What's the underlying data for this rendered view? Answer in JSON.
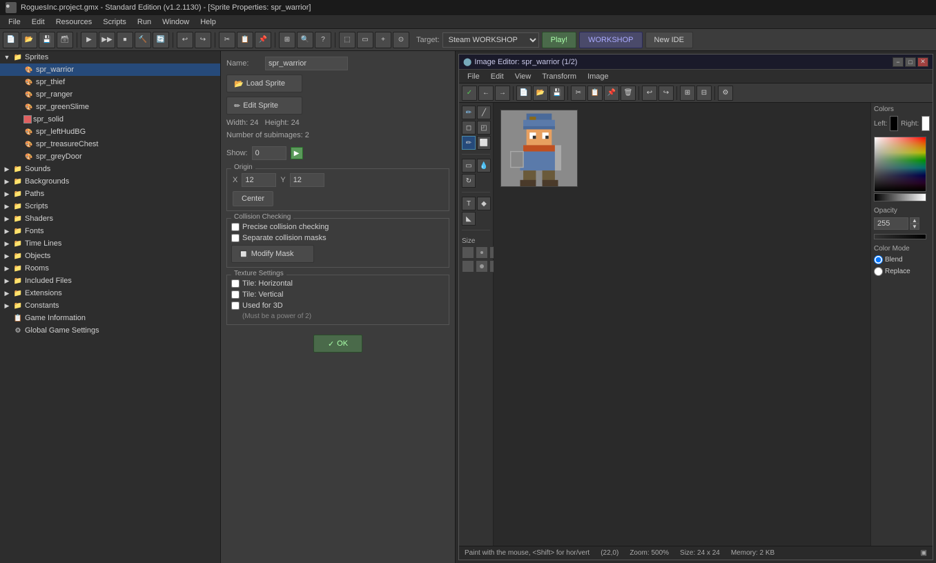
{
  "titlebar": {
    "title": "RoguesInc.project.gmx - Standard Edition (v1.2.1130) - [Sprite Properties: spr_warrior]",
    "icon": "●"
  },
  "menubar": {
    "items": [
      "File",
      "Edit",
      "Resources",
      "Scripts",
      "Run",
      "Window",
      "Help"
    ]
  },
  "toolbar": {
    "target_label": "Target:",
    "target_value": "Steam WORKSHOP",
    "play_label": "Play!",
    "workshop_label": "WORKSHOP",
    "newide_label": "New IDE"
  },
  "resource_tree": {
    "items": [
      {
        "id": "sprites",
        "label": "Sprites",
        "type": "folder",
        "level": 1,
        "expanded": true
      },
      {
        "id": "spr_warrior",
        "label": "spr_warrior",
        "type": "sprite",
        "level": 2,
        "selected": true
      },
      {
        "id": "spr_thief",
        "label": "spr_thief",
        "type": "sprite",
        "level": 2
      },
      {
        "id": "spr_ranger",
        "label": "spr_ranger",
        "type": "sprite",
        "level": 2
      },
      {
        "id": "spr_greenSlime",
        "label": "spr_greenSlime",
        "type": "sprite",
        "level": 2
      },
      {
        "id": "spr_solid",
        "label": "spr_solid",
        "type": "sprite",
        "level": 2
      },
      {
        "id": "spr_leftHudBG",
        "label": "spr_leftHudBG",
        "type": "sprite",
        "level": 2
      },
      {
        "id": "spr_treasureChest",
        "label": "spr_treasureChest",
        "type": "sprite",
        "level": 2
      },
      {
        "id": "spr_greyDoor",
        "label": "spr_greyDoor",
        "type": "sprite",
        "level": 2
      },
      {
        "id": "sounds",
        "label": "Sounds",
        "type": "folder",
        "level": 1
      },
      {
        "id": "backgrounds",
        "label": "Backgrounds",
        "type": "folder",
        "level": 1
      },
      {
        "id": "paths",
        "label": "Paths",
        "type": "folder",
        "level": 1
      },
      {
        "id": "scripts",
        "label": "Scripts",
        "type": "folder",
        "level": 1
      },
      {
        "id": "shaders",
        "label": "Shaders",
        "type": "folder",
        "level": 1
      },
      {
        "id": "fonts",
        "label": "Fonts",
        "type": "folder",
        "level": 1
      },
      {
        "id": "timelines",
        "label": "Time Lines",
        "type": "folder",
        "level": 1
      },
      {
        "id": "objects",
        "label": "Objects",
        "type": "folder",
        "level": 1
      },
      {
        "id": "rooms",
        "label": "Rooms",
        "type": "folder",
        "level": 1
      },
      {
        "id": "included_files",
        "label": "Included Files",
        "type": "folder",
        "level": 1
      },
      {
        "id": "extensions",
        "label": "Extensions",
        "type": "folder",
        "level": 1
      },
      {
        "id": "constants",
        "label": "Constants",
        "type": "folder",
        "level": 1
      },
      {
        "id": "game_info",
        "label": "Game Information",
        "type": "item",
        "level": 1
      },
      {
        "id": "global_settings",
        "label": "Global Game Settings",
        "type": "item",
        "level": 1
      }
    ]
  },
  "sprite_props": {
    "name_label": "Name:",
    "name_value": "spr_warrior",
    "load_sprite_label": "Load Sprite",
    "edit_sprite_label": "Edit Sprite",
    "width_label": "Width: 24",
    "height_label": "Height: 24",
    "subimages_label": "Number of subimages: 2",
    "show_label": "Show:",
    "show_value": "0",
    "origin_title": "Origin",
    "origin_x_label": "X",
    "origin_x_value": "12",
    "origin_y_label": "Y",
    "origin_y_value": "12",
    "center_label": "Center",
    "ok_label": "OK",
    "collision_title": "Collision Checking",
    "precise_label": "Precise collision checking",
    "separate_label": "Separate collision masks",
    "modify_mask_label": "Modify Mask",
    "texture_title": "Texture Settings",
    "tile_h_label": "Tile: Horizontal",
    "tile_v_label": "Tile: Vertical",
    "used_3d_label": "Used for 3D",
    "used_3d_sub": "(Must be a power of 2)"
  },
  "image_editor": {
    "title": "Image Editor: spr_warrior (1/2)",
    "menu_items": [
      "File",
      "Edit",
      "View",
      "Transform",
      "Image"
    ],
    "status_text": "Paint with the mouse, <Shift> for hor/vert",
    "coords": "(22,0)",
    "zoom": "Zoom: 500%",
    "size": "Size: 24 x 24",
    "memory": "Memory: 2 KB"
  },
  "colors": {
    "title": "Colors",
    "left_label": "Left:",
    "right_label": "Right:",
    "left_color": "#000000",
    "right_color": "#ffffff",
    "opacity_label": "Opacity",
    "opacity_value": "255",
    "colormode_label": "Color Mode",
    "blend_label": "Blend",
    "replace_label": "Replace"
  },
  "icons": {
    "checkmark": "✓",
    "arrow_left": "←",
    "arrow_right": "→",
    "pencil": "✏",
    "grid": "⊞",
    "close": "✕",
    "minimize": "−",
    "maximize": "□",
    "folder": "📁",
    "up_arrow": "▲",
    "down_arrow": "▼"
  }
}
